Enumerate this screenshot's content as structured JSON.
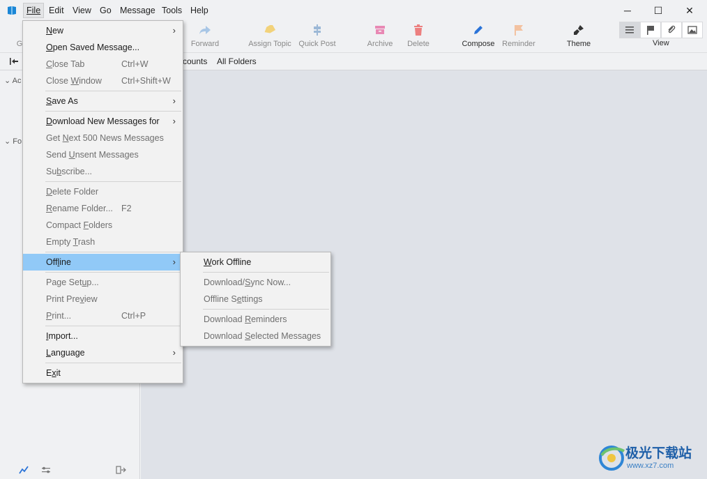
{
  "menubar": {
    "items": [
      "File",
      "Edit",
      "View",
      "Go",
      "Message",
      "Tools",
      "Help"
    ],
    "active": "File"
  },
  "window_controls": {
    "minimize": "─",
    "maximize": "☐",
    "close": "✕"
  },
  "toolbar": {
    "get": "G",
    "forward": "Forward",
    "assign_topic": "Assign Topic",
    "quick_post": "Quick Post",
    "archive": "Archive",
    "delete": "Delete",
    "compose": "Compose",
    "reminder": "Reminder",
    "theme": "Theme",
    "view": "View"
  },
  "tabbar": {
    "accounts": "counts",
    "all_folders": "All Folders"
  },
  "sidebar": {
    "accounts_section": "Ac",
    "folders_section": "Fo"
  },
  "file_menu": [
    {
      "label": "New",
      "underline": "N",
      "rest": "ew",
      "submenu": true,
      "disabled": false
    },
    {
      "label": "Open Saved Message...",
      "underline": "O",
      "rest": "pen Saved Message...",
      "disabled": false
    },
    {
      "label": "Close Tab",
      "underline": "C",
      "rest": "lose Tab",
      "shortcut": "Ctrl+W",
      "disabled": true
    },
    {
      "label": "Close Window",
      "pre": "Close ",
      "underline": "W",
      "rest": "indow",
      "shortcut": "Ctrl+Shift+W",
      "disabled": true
    },
    {
      "sep": true
    },
    {
      "label": "Save As",
      "underline": "S",
      "rest": "ave As",
      "submenu": true,
      "disabled": false
    },
    {
      "sep": true
    },
    {
      "label": "Download New Messages for",
      "underline": "D",
      "rest": "ownload New Messages for",
      "submenu": true,
      "disabled": false
    },
    {
      "label": "Get Next 500 News Messages",
      "pre": "Get ",
      "underline": "N",
      "rest": "ext 500 News Messages",
      "disabled": true
    },
    {
      "label": "Send Unsent Messages",
      "pre": "Send ",
      "underline": "U",
      "rest": "nsent Messages",
      "disabled": true
    },
    {
      "label": "Subscribe...",
      "pre": "Su",
      "underline": "b",
      "rest": "scribe...",
      "disabled": true
    },
    {
      "sep": true
    },
    {
      "label": "Delete Folder",
      "underline": "D",
      "rest": "elete Folder",
      "disabled": true
    },
    {
      "label": "Rename Folder...",
      "underline": "R",
      "rest": "ename Folder...",
      "shortcut": "F2",
      "disabled": true
    },
    {
      "label": "Compact Folders",
      "pre": "Compact ",
      "underline": "F",
      "rest": "olders",
      "disabled": true
    },
    {
      "label": "Empty Trash",
      "pre": "Empty ",
      "underline": "T",
      "rest": "rash",
      "disabled": true
    },
    {
      "sep": true
    },
    {
      "label": "Offline",
      "pre": "Off",
      "underline": "l",
      "rest": "ine",
      "submenu": true,
      "disabled": false,
      "highlighted": true
    },
    {
      "sep": true
    },
    {
      "label": "Page Setup...",
      "pre": "Page Set",
      "underline": "u",
      "rest": "p...",
      "disabled": true
    },
    {
      "label": "Print Preview",
      "pre": "Print Pre",
      "underline": "v",
      "rest": "iew",
      "disabled": true
    },
    {
      "label": "Print...",
      "underline": "P",
      "rest": "rint...",
      "shortcut": "Ctrl+P",
      "disabled": true
    },
    {
      "sep": true
    },
    {
      "label": "Import...",
      "underline": "I",
      "rest": "mport...",
      "disabled": false
    },
    {
      "label": "Language",
      "underline": "L",
      "rest": "anguage",
      "submenu": true,
      "disabled": false
    },
    {
      "sep": true
    },
    {
      "label": "Exit",
      "pre": "E",
      "underline": "x",
      "rest": "it",
      "disabled": false
    }
  ],
  "offline_menu": [
    {
      "label": "Work Offline",
      "underline": "W",
      "rest": "ork Offline",
      "disabled": false
    },
    {
      "sep": true
    },
    {
      "label": "Download/Sync Now...",
      "pre": "Download/",
      "underline": "S",
      "rest": "ync Now...",
      "disabled": true
    },
    {
      "label": "Offline Settings",
      "pre": "Offline S",
      "underline": "e",
      "rest": "ttings",
      "disabled": true
    },
    {
      "sep": true
    },
    {
      "label": "Download Reminders",
      "pre": "Download ",
      "underline": "R",
      "rest": "eminders",
      "disabled": true
    },
    {
      "label": "Download Selected Messages",
      "pre": "Download ",
      "underline": "S",
      "rest": "elected Messages",
      "disabled": true
    }
  ],
  "watermark": {
    "big": "极光下载站",
    "small": "www.xz7.com"
  },
  "colors": {
    "highlight": "#91c9f7",
    "compose": "#2a73d8",
    "archive": "#e889b4",
    "delete": "#ec7f7f",
    "assign_topic": "#f2d27a",
    "quick_post": "#9cb8d6",
    "reminder": "#f3c2a0"
  }
}
